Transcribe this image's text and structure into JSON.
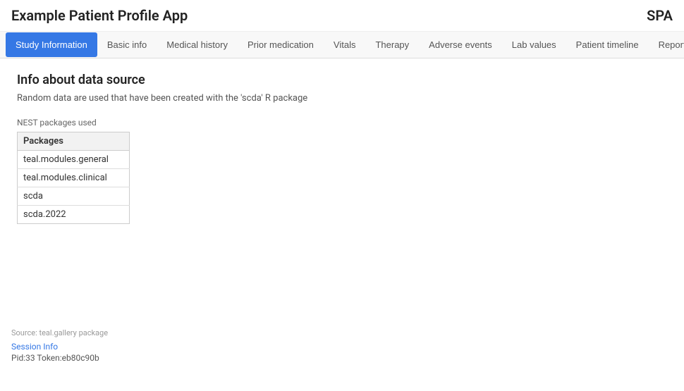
{
  "header": {
    "app_title": "Example Patient Profile App",
    "spa_label": "SPA"
  },
  "nav": {
    "items": [
      {
        "id": "study-information",
        "label": "Study Information",
        "active": true
      },
      {
        "id": "basic-info",
        "label": "Basic info",
        "active": false
      },
      {
        "id": "medical-history",
        "label": "Medical history",
        "active": false
      },
      {
        "id": "prior-medication",
        "label": "Prior medication",
        "active": false
      },
      {
        "id": "vitals",
        "label": "Vitals",
        "active": false
      },
      {
        "id": "therapy",
        "label": "Therapy",
        "active": false
      },
      {
        "id": "adverse-events",
        "label": "Adverse events",
        "active": false
      },
      {
        "id": "lab-values",
        "label": "Lab values",
        "active": false
      },
      {
        "id": "patient-timeline",
        "label": "Patient timeline",
        "active": false
      },
      {
        "id": "report-previewer",
        "label": "Report previewer",
        "active": false
      }
    ],
    "hamburger_icon": "☰"
  },
  "main": {
    "title": "Info about data source",
    "subtitle": "Random data are used that have been created with the 'scda' R package",
    "nest_label": "NEST packages used",
    "table": {
      "column_header": "Packages",
      "rows": [
        {
          "package": "teal.modules.general"
        },
        {
          "package": "teal.modules.clinical"
        },
        {
          "package": "scda"
        },
        {
          "package": "scda.2022"
        }
      ]
    }
  },
  "footer": {
    "source_text": "Source: teal.gallery package",
    "session_info_label": "Session Info",
    "session_info_text": "Pid:33 Token:eb80c90b"
  }
}
